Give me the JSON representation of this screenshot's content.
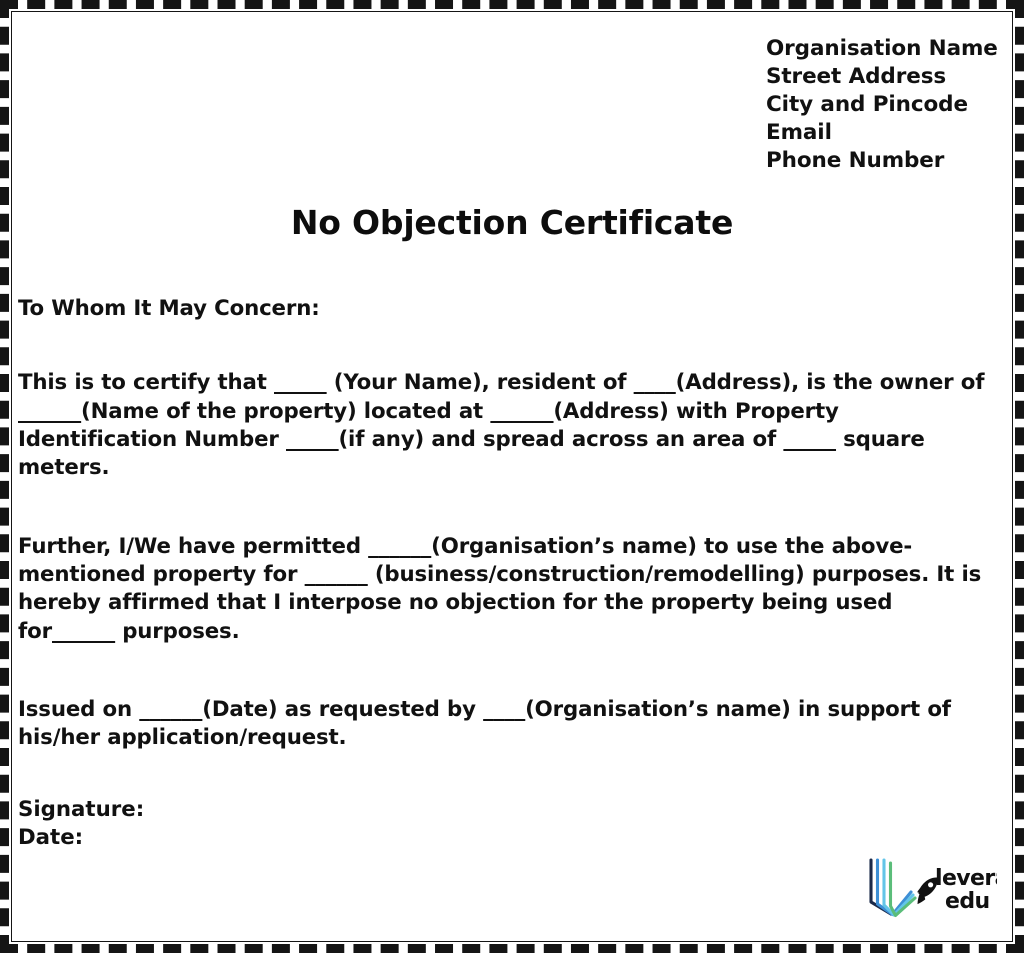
{
  "document": {
    "title": "No Objection Certificate"
  },
  "letterhead": {
    "lines": [
      "Organisation Name",
      "Street Address",
      "City and Pincode",
      "Email",
      "Phone Number"
    ]
  },
  "body": {
    "salutation": "To Whom It May Concern:",
    "paragraphs": [
      "This is to certify that _____ (Your Name), resident of ____(Address), is the owner of ______(Name of the property) located at ______(Address) with Property Identification Number _____(if any) and spread across an area of _____ square meters.",
      "Further, I/We have permitted ______(Organisation’s name) to use the above-mentioned property for ______ (business/construction/remodelling) purposes. It is hereby affirmed that I interpose no objection for the property being used for______ purposes.",
      "Issued on ______(Date) as requested by ____(Organisation’s name) in support of his/her application/request."
    ]
  },
  "signature_block": {
    "signature_label": "Signature:",
    "date_label": "Date:"
  },
  "logo": {
    "name": "leverage-edu-logo",
    "line1": "leverage",
    "line2": "edu",
    "colors": {
      "stroke_dark": "#1b2a4a",
      "stroke_blue": "#3d8fd6",
      "stroke_cyan": "#63c5e8",
      "stroke_green": "#5bbd7a",
      "text": "#111111"
    }
  },
  "theme": {
    "page_background": "#ffffff",
    "border_color": "#151515",
    "text_color": "#111111"
  }
}
